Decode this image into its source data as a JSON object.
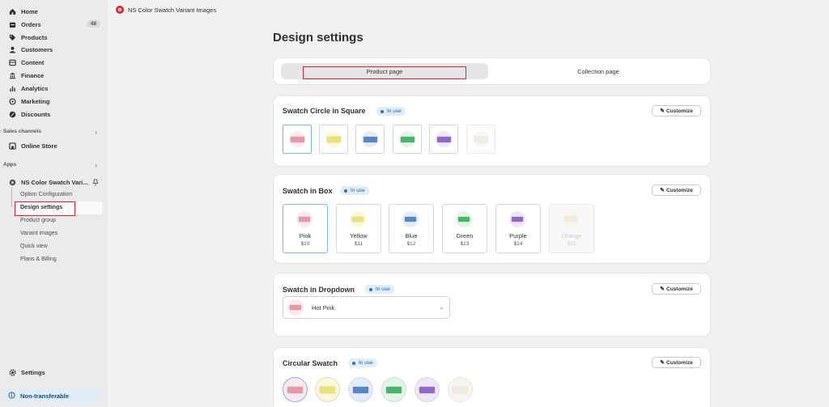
{
  "sidebar": {
    "nav": [
      {
        "label": "Home",
        "icon": "home-icon"
      },
      {
        "label": "Orders",
        "icon": "orders-icon",
        "badge": "48"
      },
      {
        "label": "Products",
        "icon": "tag-icon"
      },
      {
        "label": "Customers",
        "icon": "person-icon"
      },
      {
        "label": "Content",
        "icon": "content-icon"
      },
      {
        "label": "Finance",
        "icon": "bank-icon"
      },
      {
        "label": "Analytics",
        "icon": "chart-icon"
      },
      {
        "label": "Marketing",
        "icon": "target-icon"
      },
      {
        "label": "Discounts",
        "icon": "discount-icon"
      }
    ],
    "sales_channels_label": "Sales channels",
    "online_store": "Online Store",
    "apps_label": "Apps",
    "app_name": "NS Color Swatch Vari...",
    "app_subitems": [
      "Option Configuration",
      "Design settings",
      "Product group",
      "Variant images",
      "Quick view",
      "Plans & Billing"
    ],
    "settings": "Settings",
    "non_transferable": "Non-transferable"
  },
  "topbar": {
    "app_title": "NS Color Swatch Variant Images"
  },
  "page": {
    "title": "Design settings",
    "tabs": [
      "Product page",
      "Collection page"
    ],
    "in_use": "In use",
    "customize": "Customize"
  },
  "cards": {
    "square": {
      "title": "Swatch Circle in Square"
    },
    "box": {
      "title": "Swatch in Box",
      "items": [
        {
          "name": "Pink",
          "price": "$10"
        },
        {
          "name": "Yellow",
          "price": "$11"
        },
        {
          "name": "Blue",
          "price": "$12"
        },
        {
          "name": "Green",
          "price": "$13"
        },
        {
          "name": "Purple",
          "price": "$14"
        },
        {
          "name": "Orange",
          "price": "$15"
        }
      ]
    },
    "dropdown": {
      "title": "Swatch in Dropdown",
      "selected": "Hot Pink"
    },
    "circular": {
      "title": "Circular Swatch"
    }
  },
  "colors": {
    "pink": "#e49aa8",
    "yellow": "#ece27a",
    "blue": "#5a86c5",
    "green": "#48b36a",
    "purple": "#8f6ac7",
    "beige": "#e8ddd1",
    "pink_bg": "#fde8ec",
    "yellow_bg": "#fdf8d8",
    "blue_bg": "#e2ecfb",
    "green_bg": "#e0f5e6",
    "purple_bg": "#efe6fb",
    "beige_bg": "#f4efe8",
    "accent_red": "#e0242e",
    "selected_border": "#7fb3e8"
  }
}
